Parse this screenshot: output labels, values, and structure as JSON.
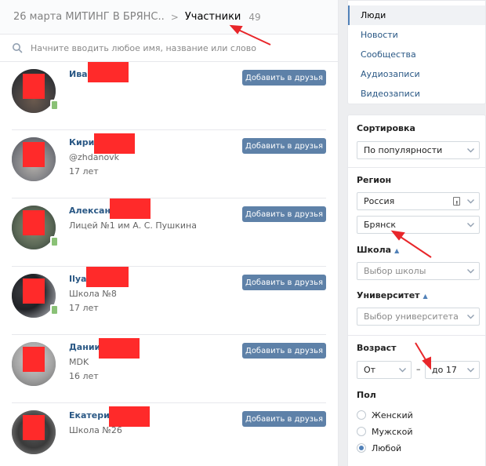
{
  "breadcrumbs": {
    "group": "26 марта МИТИНГ В БРЯНС..",
    "separator": ">",
    "current": "Участники",
    "count": "49"
  },
  "search": {
    "placeholder": "Начните вводить любое имя, название или слово"
  },
  "people": [
    {
      "name": "Иван",
      "line1": "",
      "line2": "",
      "online_mobile": true,
      "add_label": "Добавить в друзья"
    },
    {
      "name": "Кирилл",
      "line1": "@zhdanovk",
      "line2": "17 лет",
      "online_mobile": false,
      "add_label": "Добавить в друзья"
    },
    {
      "name": "Александр",
      "line1": "Лицей №1 им А. С. Пушкина",
      "line2": "",
      "online_mobile": true,
      "add_label": "Добавить в друзья"
    },
    {
      "name": "Ilya E",
      "line1": "Школа №8",
      "line2": "17 лет",
      "online_mobile": true,
      "add_label": "Добавить в друзья"
    },
    {
      "name": "Даниил",
      "line1": "MDK",
      "line2": "16 лет",
      "online_mobile": false,
      "add_label": "Добавить в друзья"
    },
    {
      "name": "Екатерина",
      "line1": "Школа №26",
      "line2": "",
      "online_mobile": false,
      "add_label": "Добавить в друзья"
    }
  ],
  "menu": {
    "items": [
      "Люди",
      "Новости",
      "Сообщества",
      "Аудиозаписи",
      "Видеозаписи"
    ],
    "active": "Люди"
  },
  "filters": {
    "sort_label": "Сортировка",
    "sort_value": "По популярности",
    "region_label": "Регион",
    "country_value": "Россия",
    "city_value": "Брянск",
    "school_label": "Школа",
    "school_placeholder": "Выбор школы",
    "university_label": "Университет",
    "university_placeholder": "Выбор университета",
    "age_label": "Возраст",
    "age_from": "От",
    "age_separator": "–",
    "age_to": "до 17",
    "gender_label": "Пол",
    "gender_options": [
      "Женский",
      "Мужской",
      "Любой"
    ],
    "gender_selected": "Любой"
  },
  "colors": {
    "link": "#2a5885",
    "button": "#5e81a8",
    "accent": "#5181b8",
    "redaction": "#ff2a2a",
    "annotation_arrow": "#e8262a"
  }
}
